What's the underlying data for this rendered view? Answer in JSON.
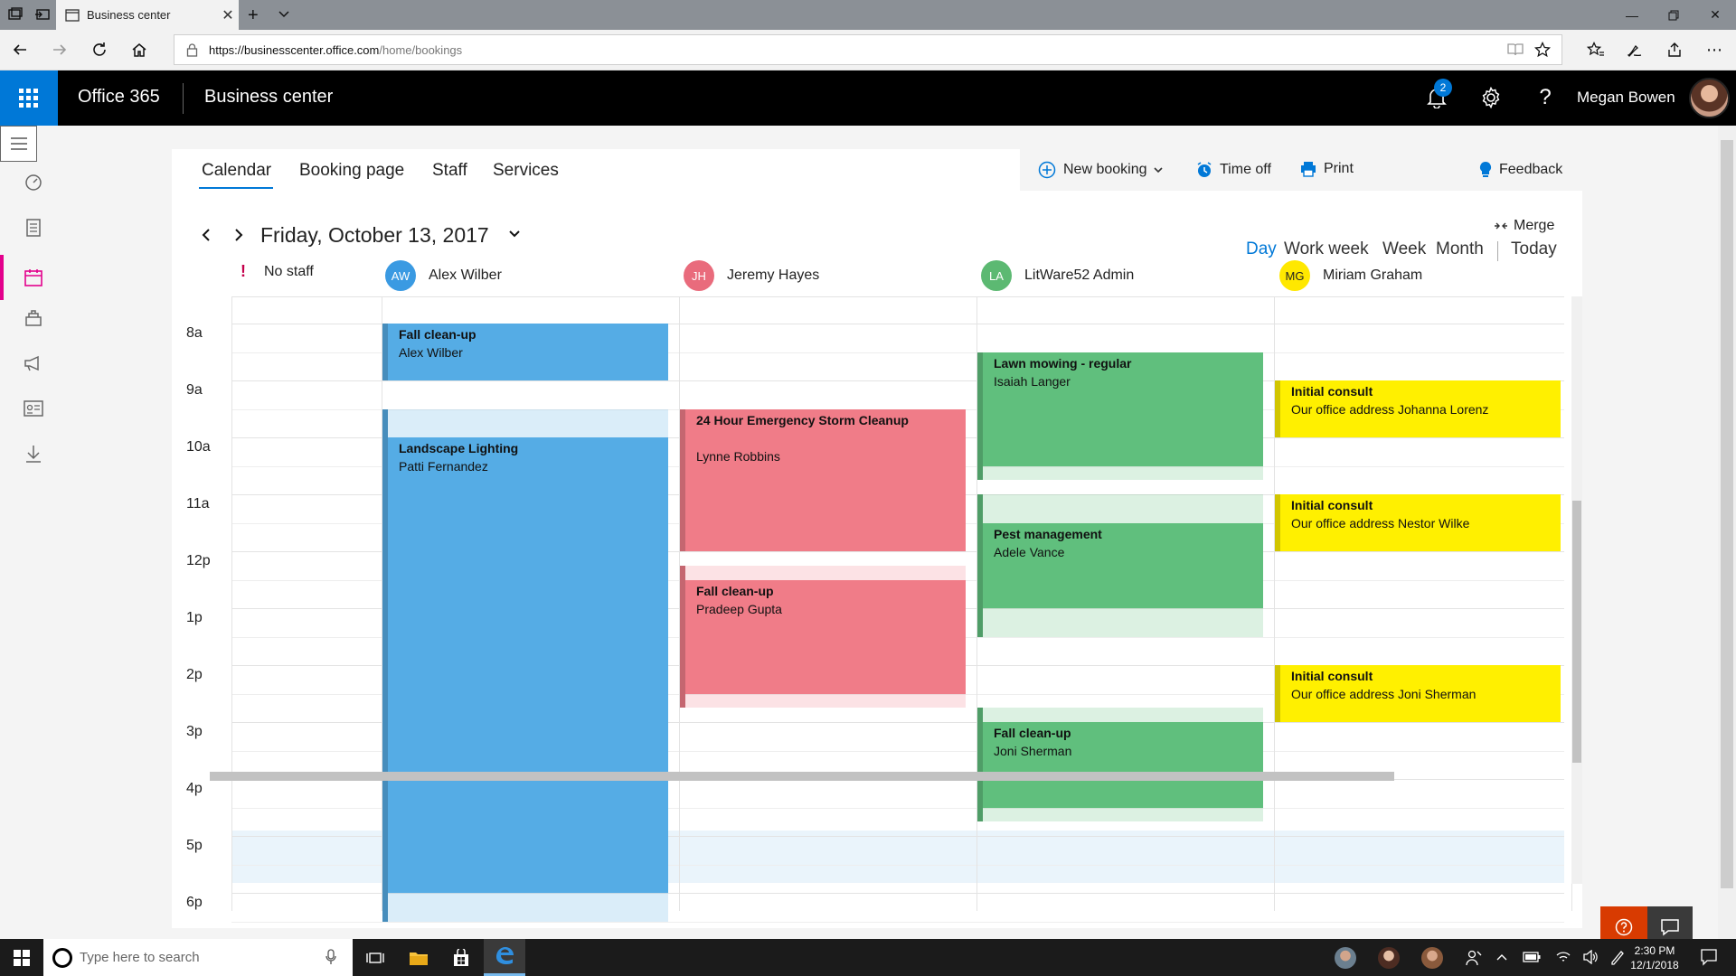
{
  "browser": {
    "tab_title": "Business center",
    "url_host": "https://businesscenter.office.com",
    "url_path": "/home/bookings"
  },
  "header": {
    "suite_title": "Office 365",
    "app_title": "Business center",
    "notification_count": "2",
    "user_name": "Megan Bowen"
  },
  "tabs": [
    {
      "label": "Calendar"
    },
    {
      "label": "Booking page"
    },
    {
      "label": "Staff"
    },
    {
      "label": "Services"
    }
  ],
  "actions": {
    "new_booking": "New booking",
    "time_off": "Time off",
    "print": "Print",
    "feedback": "Feedback"
  },
  "date_label": "Friday, October 13, 2017",
  "merge_label": "Merge",
  "views": {
    "day": "Day",
    "work_week": "Work week",
    "week": "Week",
    "month": "Month",
    "today": "Today",
    "active": "Day"
  },
  "staff": {
    "no_staff": "No staff",
    "members": [
      {
        "initials": "AW",
        "name": "Alex Wilber",
        "color": "#3a9ae2"
      },
      {
        "initials": "JH",
        "name": "Jeremy Hayes",
        "color": "#e96b7c"
      },
      {
        "initials": "LA",
        "name": "LitWare52 Admin",
        "color": "#5cb972"
      },
      {
        "initials": "MG",
        "name": "Miriam Graham",
        "color": "#ffe800"
      }
    ]
  },
  "time_labels": [
    "8a",
    "9a",
    "10a",
    "11a",
    "12p",
    "1p",
    "2p",
    "3p",
    "4p",
    "5p",
    "6p"
  ],
  "bookings": [
    {
      "title": "Fall clean-up",
      "detail": "Alex Wilber",
      "column": 1,
      "start": 8.0,
      "end": 9.0,
      "color": "#55ace5",
      "pad_before": 0,
      "pad_after": 0
    },
    {
      "title": "Landscape Lighting",
      "detail": "Patti Fernandez",
      "column": 1,
      "start": 10.0,
      "end": 18.0,
      "color": "#55ace5",
      "pad_before": 0.5,
      "pad_after": 0.5
    },
    {
      "title": "24 Hour Emergency Storm Cleanup",
      "detail": "Lynne Robbins",
      "column": 2,
      "start": 9.5,
      "end": 12.0,
      "color": "#f07c88",
      "pad_before": 0,
      "pad_after": 0,
      "detail_offset": true
    },
    {
      "title": "Fall clean-up",
      "detail": "Pradeep Gupta",
      "column": 2,
      "start": 12.5,
      "end": 14.5,
      "color": "#f07c88",
      "pad_before": 0.25,
      "pad_after": 0.25
    },
    {
      "title": "Lawn mowing - regular",
      "detail": "Isaiah Langer",
      "column": 3,
      "start": 8.5,
      "end": 10.5,
      "color": "#60bf7d",
      "pad_before": 0,
      "pad_after": 0.25
    },
    {
      "title": "Pest management",
      "detail": "Adele Vance",
      "column": 3,
      "start": 11.5,
      "end": 13.0,
      "color": "#60bf7d",
      "pad_before": 0.5,
      "pad_after": 0.5
    },
    {
      "title": "Fall clean-up",
      "detail": "Joni Sherman",
      "column": 3,
      "start": 15.0,
      "end": 16.5,
      "color": "#60bf7d",
      "pad_before": 0.25,
      "pad_after": 0.25
    },
    {
      "title": "Initial consult",
      "detail": "Our office address Johanna Lorenz",
      "column": 4,
      "start": 9.0,
      "end": 10.0,
      "color": "#fff000",
      "pad_before": 0,
      "pad_after": 0
    },
    {
      "title": "Initial consult",
      "detail": "Our office address Nestor Wilke",
      "column": 4,
      "start": 11.0,
      "end": 12.0,
      "color": "#fff000",
      "pad_before": 0,
      "pad_after": 0
    },
    {
      "title": "Initial consult",
      "detail": "Our office address Joni Sherman",
      "column": 4,
      "start": 14.0,
      "end": 15.0,
      "color": "#fff000",
      "pad_before": 0,
      "pad_after": 0
    }
  ],
  "taskbar": {
    "search_placeholder": "Type here to search",
    "time": "2:30 PM",
    "date": "12/1/2018"
  },
  "colors": {
    "accent": "#0078d7",
    "waffle": "#0078d7",
    "active_rail": "#e3008c",
    "help": "#d83b01"
  }
}
